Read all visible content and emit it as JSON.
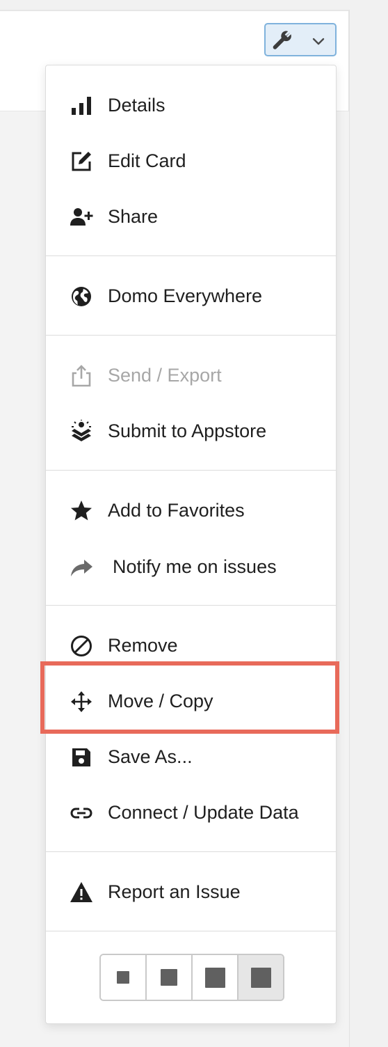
{
  "toolbar": {
    "button_icon": "wrench-icon",
    "dropdown_icon": "chevron-down-icon",
    "accent_color": "#7fb2dc"
  },
  "menu": {
    "items": [
      {
        "label": "Details",
        "icon": "bar-chart-icon"
      },
      {
        "label": "Edit Card",
        "icon": "edit-icon"
      },
      {
        "label": "Share",
        "icon": "add-user-icon"
      },
      {
        "label": "Domo Everywhere",
        "icon": "globe-icon"
      },
      {
        "label": "Send / Export",
        "icon": "share-export-icon",
        "disabled": true
      },
      {
        "label": "Submit to Appstore",
        "icon": "appstore-icon"
      },
      {
        "label": "Add to Favorites",
        "icon": "star-icon"
      },
      {
        "label": "Notify me on issues",
        "icon": "forward-arrow-icon"
      },
      {
        "label": "Remove",
        "icon": "ban-icon"
      },
      {
        "label": "Move / Copy",
        "icon": "move-icon",
        "highlighted": true
      },
      {
        "label": "Save As...",
        "icon": "save-icon"
      },
      {
        "label": "Connect / Update Data",
        "icon": "link-icon"
      },
      {
        "label": "Report an Issue",
        "icon": "warning-icon"
      }
    ]
  },
  "highlight_color": "#e86a5a",
  "card_size": {
    "options": [
      "small",
      "medium",
      "large",
      "extra-large"
    ],
    "selected": "extra-large"
  }
}
